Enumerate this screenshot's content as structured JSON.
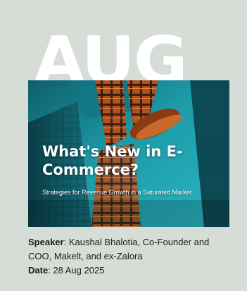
{
  "event": {
    "month": "AUG",
    "title": "What's New in E-Commerce?",
    "subtitle": "Strategies for Revenue Growth in a Saturated Market",
    "speaker_label": "Speaker",
    "speaker_value": ": Kaushal Bhalotia, Co-Founder and COO, Makelt, and ex-Zalora",
    "date_label": "Date",
    "date_value": ": 28 Aug 2025"
  },
  "colors": {
    "background": "#d6ddd6",
    "hero_teal": "#1d8a98",
    "text": "#1a1a1a"
  }
}
